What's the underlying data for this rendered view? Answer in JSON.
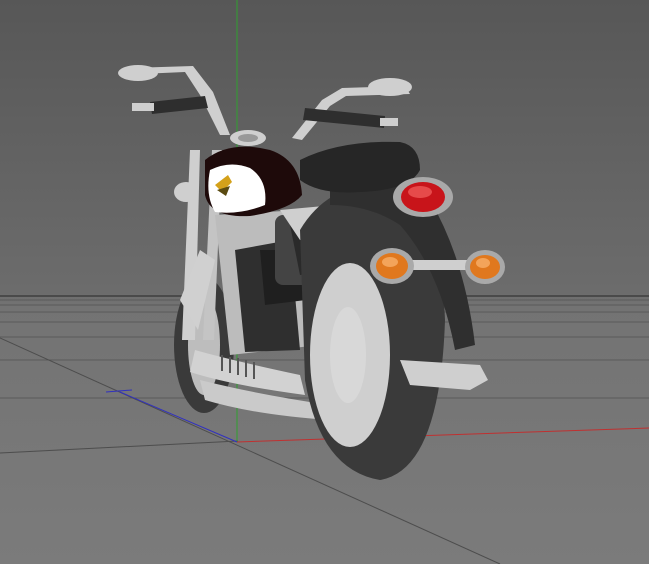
{
  "app": {
    "view": "perspective-viewport",
    "background_color": "#6b6b6b"
  },
  "scene": {
    "object": "motorcycle",
    "colors": {
      "body": "#cfcfcf",
      "tire": "#3a3a3a",
      "fender": "#2f2f2f",
      "seat": "#262626",
      "tank": "#1e0a0a",
      "tank_panel": "#ffffff",
      "tail_light": "#c8141a",
      "turn_signal": "#e0781e"
    },
    "axes": {
      "x_axis_color": "#c03030",
      "y_axis_color": "#2fa02f",
      "z_axis_color": "#3030c0"
    },
    "grid": "on"
  }
}
